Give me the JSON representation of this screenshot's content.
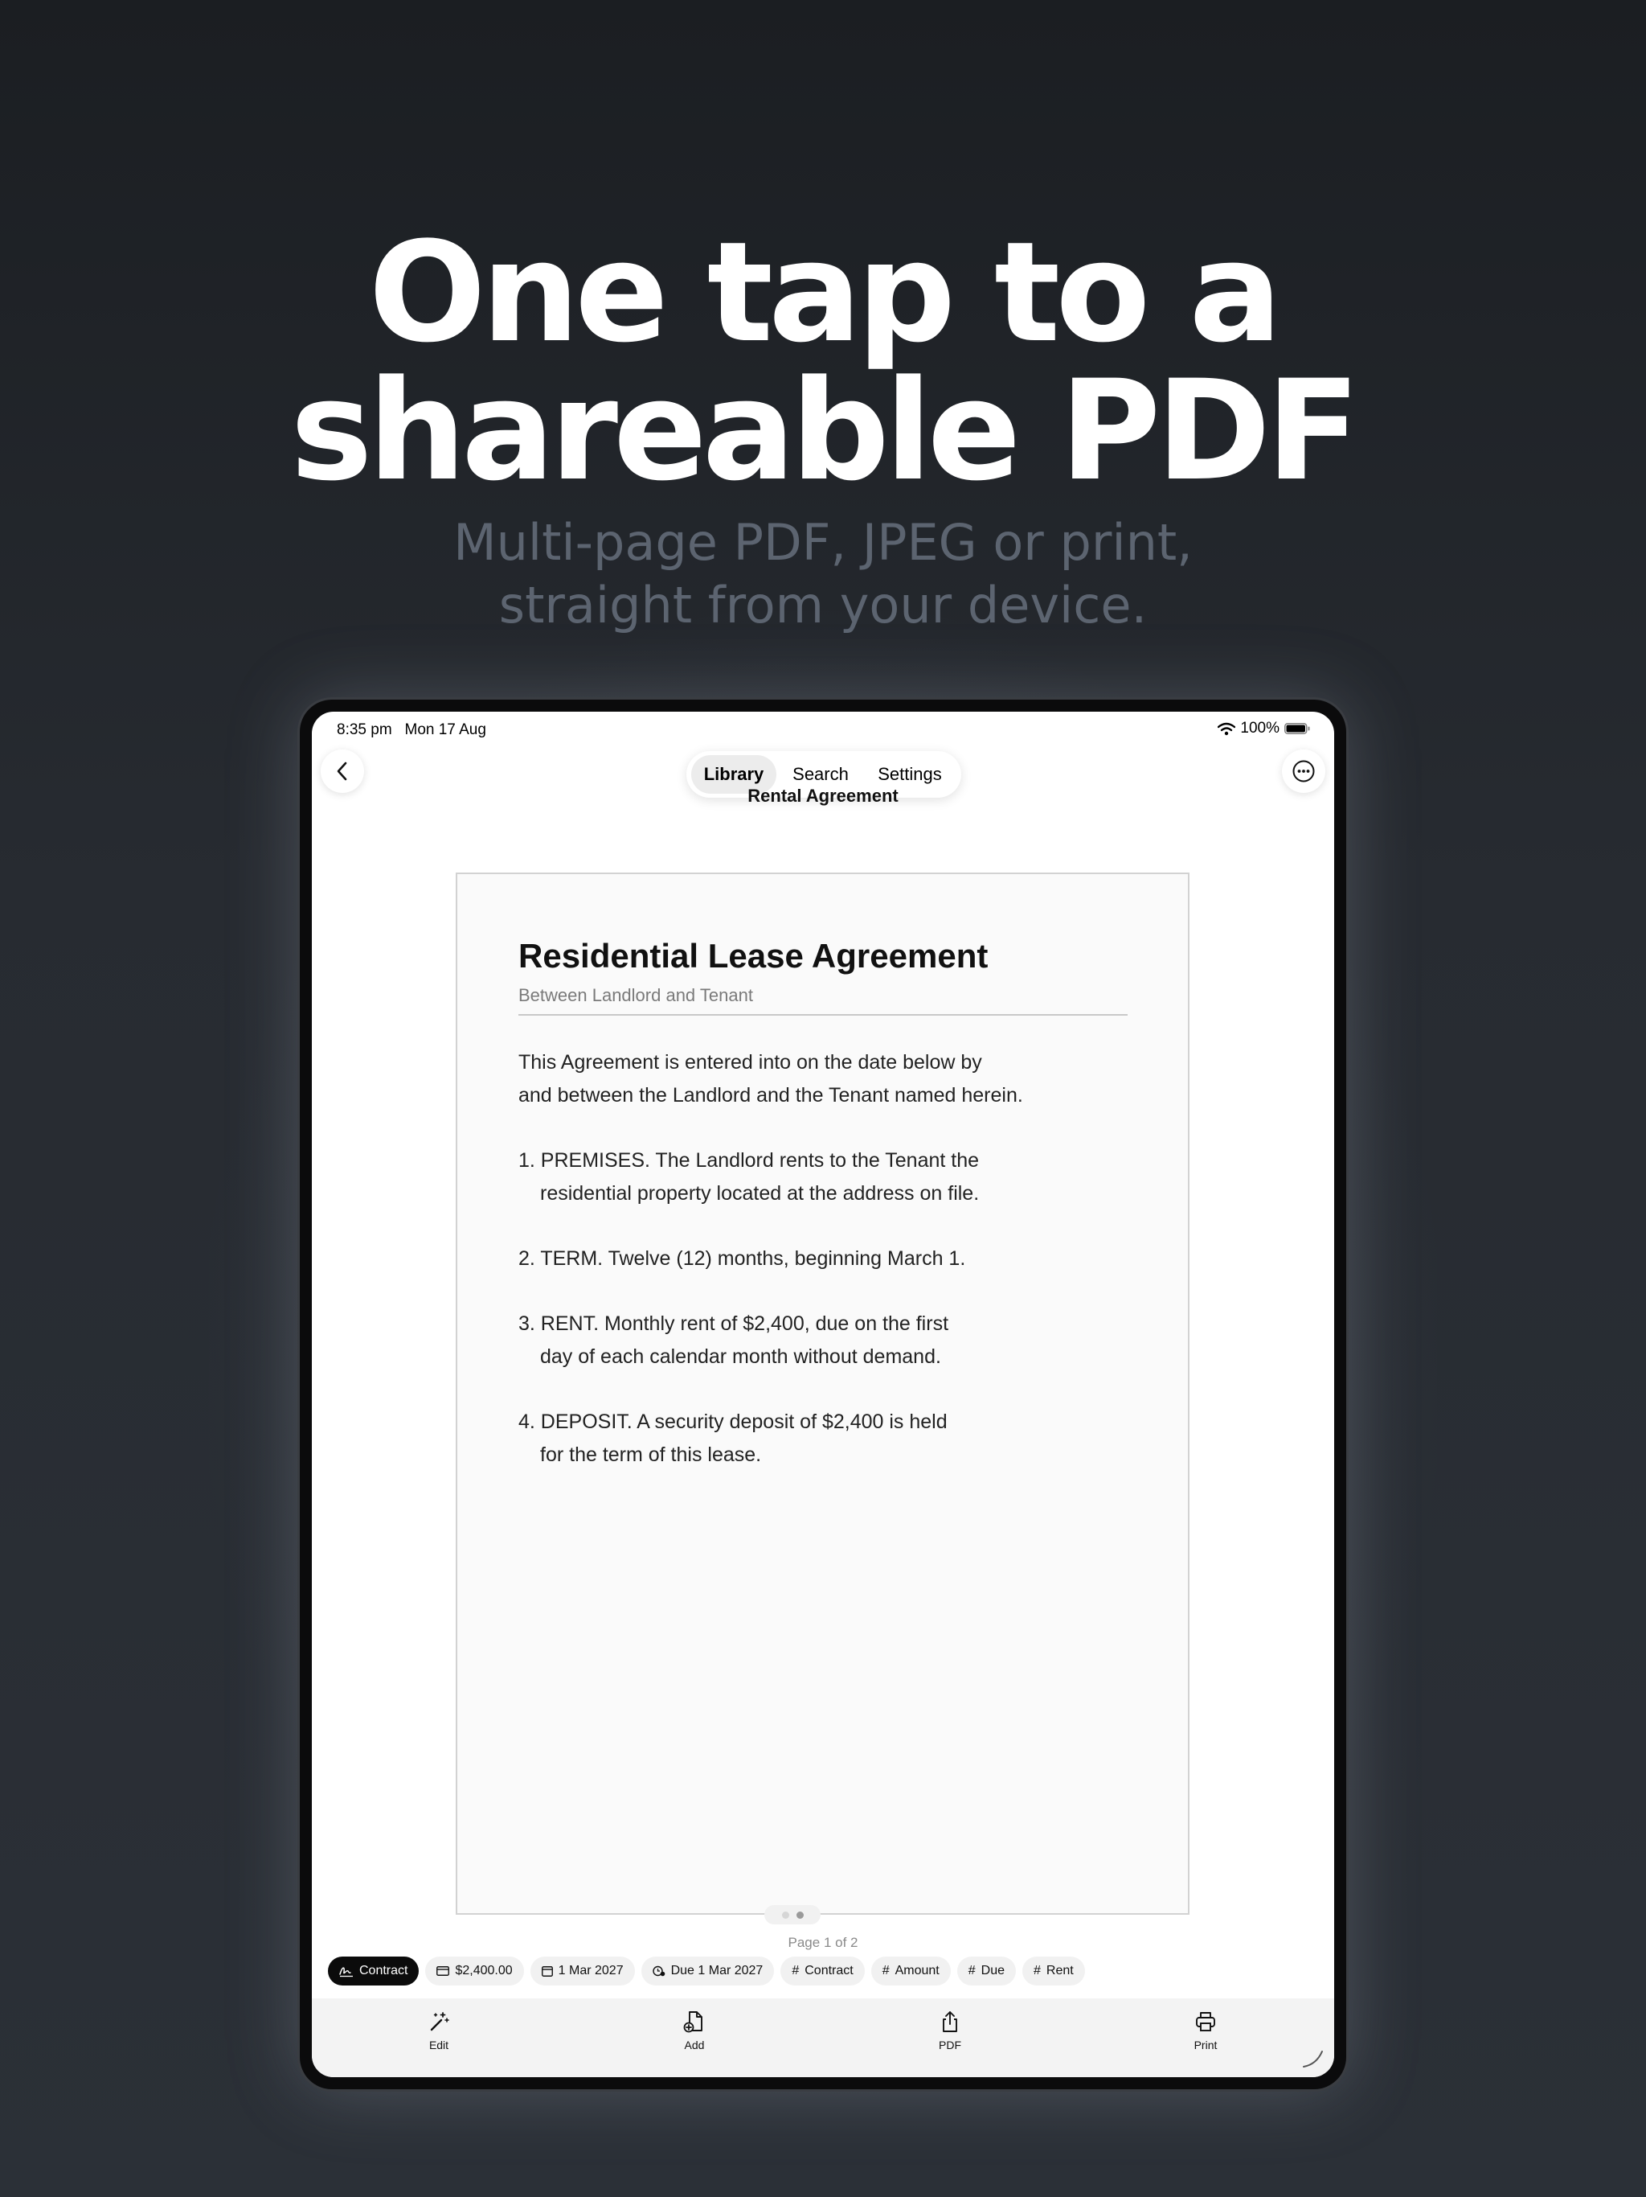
{
  "marketing": {
    "headline_line1": "One tap to a",
    "headline_line2": "shareable PDF",
    "subtitle_line1": "Multi-page PDF, JPEG or print,",
    "subtitle_line2": "straight from your device."
  },
  "status_bar": {
    "time": "8:35 pm",
    "date": "Mon 17 Aug",
    "battery": "100%"
  },
  "nav": {
    "tabs": [
      {
        "label": "Library",
        "active": true
      },
      {
        "label": "Search",
        "active": false
      },
      {
        "label": "Settings",
        "active": false
      }
    ],
    "back_icon": "chevron-left-icon",
    "more_icon": "ellipsis-circle-icon"
  },
  "document": {
    "name": "Rental Agreement",
    "title": "Residential Lease Agreement",
    "subtitle": "Between Landlord and Tenant",
    "intro": [
      "This Agreement is entered into on the date below by",
      "and between the Landlord and the Tenant named herein."
    ],
    "clauses": [
      {
        "line1": "1.  PREMISES.  The Landlord rents to the Tenant the",
        "line2": "residential property located at the address on file."
      },
      {
        "line1": "2.  TERM.  Twelve (12) months, beginning March 1.",
        "line2": ""
      },
      {
        "line1": "3.  RENT.  Monthly rent of $2,400, due on the first",
        "line2": "day of each calendar month without demand."
      },
      {
        "line1": "4.  DEPOSIT.  A security deposit of $2,400 is held",
        "line2": "for the term of this lease."
      }
    ]
  },
  "pagination": {
    "label": "Page 1 of 2",
    "current_page": 1,
    "total_pages": 2
  },
  "tags": [
    {
      "label": "Contract",
      "icon": "signature-icon",
      "active": true
    },
    {
      "label": "$2,400.00",
      "icon": "card-icon",
      "active": false
    },
    {
      "label": "1 Mar 2027",
      "icon": "calendar-icon",
      "active": false
    },
    {
      "label": "Due 1 Mar 2027",
      "icon": "clock-badge-icon",
      "active": false
    },
    {
      "label": "Contract",
      "icon": "hash-icon",
      "active": false
    },
    {
      "label": "Amount",
      "icon": "hash-icon",
      "active": false
    },
    {
      "label": "Due",
      "icon": "hash-icon",
      "active": false
    },
    {
      "label": "Rent",
      "icon": "hash-icon",
      "active": false
    }
  ],
  "toolbar": {
    "edit_label": "Edit",
    "add_label": "Add",
    "pdf_label": "PDF",
    "print_label": "Print"
  },
  "colors": {
    "background": "#23272d",
    "headline": "#ffffff",
    "subtitle": "#5c6470",
    "active_chip": "#0b0b0b"
  }
}
